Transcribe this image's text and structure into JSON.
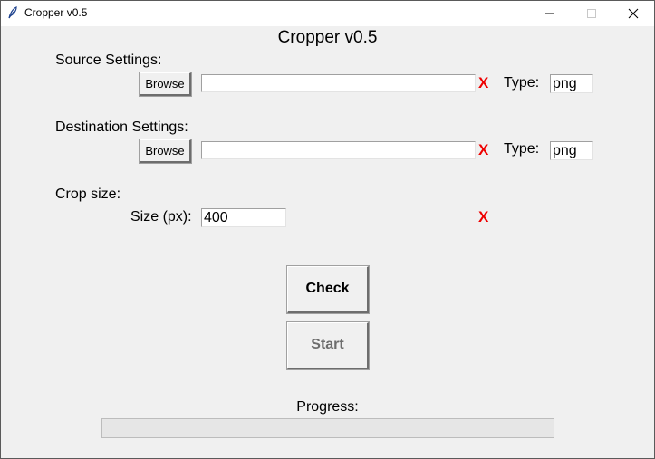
{
  "window": {
    "title": "Cropper v0.5",
    "app_icon": "feather-icon",
    "controls": [
      "minimize-icon",
      "maximize-icon",
      "close-icon"
    ]
  },
  "app": {
    "heading": "Cropper v0.5"
  },
  "source": {
    "section_label": "Source Settings:",
    "browse_label": "Browse",
    "path_value": "",
    "status_mark": "X",
    "type_label": "Type:",
    "type_value": "png"
  },
  "destination": {
    "section_label": "Destination Settings:",
    "browse_label": "Browse",
    "path_value": "",
    "status_mark": "X",
    "type_label": "Type:",
    "type_value": "png"
  },
  "crop": {
    "section_label": "Crop size:",
    "size_label": "Size (px):",
    "size_value": "400",
    "status_mark": "X"
  },
  "actions": {
    "check_label": "Check",
    "start_label": "Start",
    "start_enabled": false
  },
  "progress": {
    "label": "Progress:",
    "value": 0
  },
  "colors": {
    "window_bg": "#f0f0f0",
    "status_error": "#ee0000",
    "disabled_text": "#6d6d6d"
  }
}
